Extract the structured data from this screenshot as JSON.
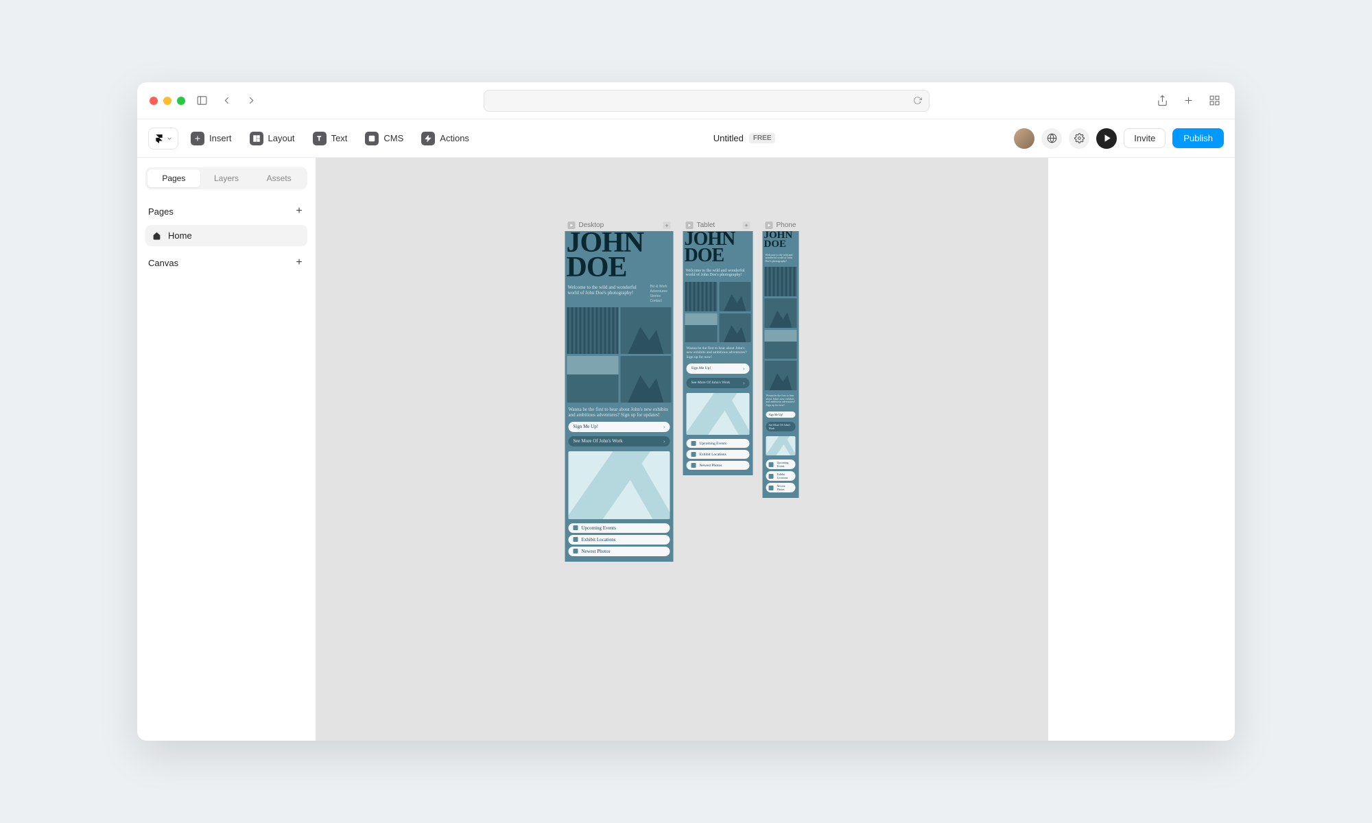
{
  "titlebar": {},
  "toolbar": {
    "items": {
      "insert": "Insert",
      "layout": "Layout",
      "text": "Text",
      "cms": "CMS",
      "actions": "Actions"
    },
    "doc_title": "Untitled",
    "badge": "FREE",
    "invite": "Invite",
    "publish": "Publish"
  },
  "sidebar": {
    "tabs": {
      "pages": "Pages",
      "layers": "Layers",
      "assets": "Assets"
    },
    "pages_header": "Pages",
    "pages": [
      {
        "name": "Home"
      }
    ],
    "canvas_header": "Canvas"
  },
  "canvas": {
    "frames": {
      "desktop": "Desktop",
      "tablet": "Tablet",
      "phone": "Phone"
    }
  },
  "design": {
    "hero_name_1": "JOHN",
    "hero_name_2": "DOE",
    "intro": "Welcome to the wild and wonderful world of John Doe's photography!",
    "intro_short": "Welcome to the wild and wonderful world of John Doe's photography!",
    "nav": {
      "a": "Bio & Work",
      "b": "Adventures",
      "c": "Stories",
      "d": "Contact"
    },
    "sub": "Wanna be the first to hear about John's new exhibits and ambitious adventures? Sign up for updates!",
    "sub_short": "Wanna be the first to hear about John's new exhibits and ambitious adventures? Sign up for now!",
    "signup": "Sign Me Up!",
    "more": "See More Of John's Work",
    "links": {
      "a": "Upcoming Events",
      "b": "Exhibit Locations",
      "c": "Newest Photos"
    }
  }
}
